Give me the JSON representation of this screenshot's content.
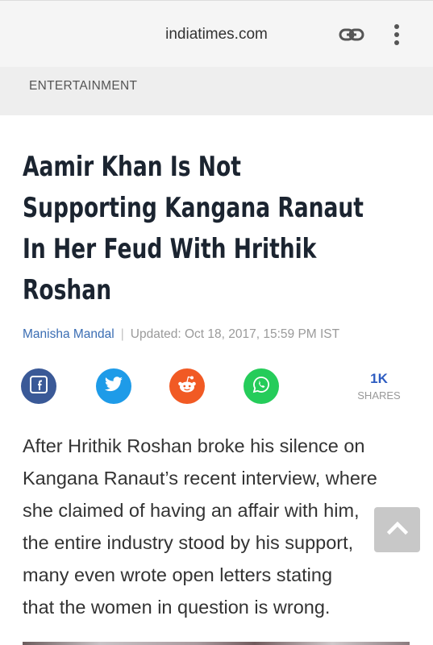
{
  "browser": {
    "domain": "indiatimes.com",
    "link_icon": "link-icon",
    "menu_icon": "more-vert-icon"
  },
  "category": "ENTERTAINMENT",
  "article": {
    "title_lines": [
      "Aamir Khan Is Not",
      "Supporting Kangana Ranaut",
      "In Her Feud With Hrithik",
      "Roshan"
    ],
    "author": "Manisha Mandal",
    "separator": "|",
    "updated": "Updated: Oct 18, 2017, 15:59 PM IST",
    "body_lines": [
      "After Hrithik Roshan broke his silence on",
      "Kangana Ranaut’s recent interview, where",
      "she claimed of having an affair with him,",
      "the entire industry stood by his support,",
      "many even wrote open letters stating",
      "that the women in question is wrong."
    ]
  },
  "share": {
    "buttons": [
      {
        "name": "facebook",
        "icon": "facebook-icon",
        "color": "#3a5997"
      },
      {
        "name": "twitter",
        "icon": "twitter-icon",
        "color": "#1e9be8"
      },
      {
        "name": "reddit",
        "icon": "reddit-icon",
        "color": "#f15a24"
      },
      {
        "name": "whatsapp",
        "icon": "whatsapp-icon",
        "color": "#25cc5a"
      }
    ],
    "count": "1K",
    "count_label": "SHARES"
  },
  "back_to_top_icon": "chevron-up-icon"
}
